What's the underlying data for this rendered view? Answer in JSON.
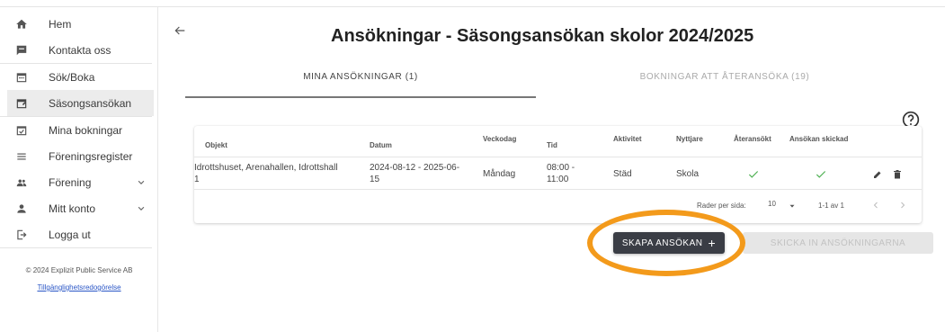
{
  "sidebar": {
    "items": [
      {
        "label": "Hem",
        "icon": "home-icon"
      },
      {
        "label": "Kontakta oss",
        "icon": "message-icon"
      },
      {
        "label": "Sök/Boka",
        "icon": "calendar-icon"
      },
      {
        "label": "Säsongsansökan",
        "icon": "calendar-edit-icon",
        "active": true
      },
      {
        "label": "Mina bokningar",
        "icon": "calendar-check-icon"
      },
      {
        "label": "Föreningsregister",
        "icon": "list-icon"
      },
      {
        "label": "Förening",
        "icon": "group-icon",
        "expandable": true
      },
      {
        "label": "Mitt konto",
        "icon": "person-icon",
        "expandable": true
      },
      {
        "label": "Logga ut",
        "icon": "logout-icon"
      }
    ],
    "copyright": "© 2024 Explizit Public Service AB",
    "accessibility_link": "Tillgänglighetsredogörelse"
  },
  "header": {
    "title": "Ansökningar - Säsongsansökan skolor 2024/2025"
  },
  "tabs": [
    {
      "label": "MINA ANSÖKNINGAR (1)",
      "active": true
    },
    {
      "label": "BOKNINGAR ATT ÅTERANSÖKA (19)",
      "active": false
    }
  ],
  "table": {
    "columns": [
      "Objekt",
      "Datum",
      "Veckodag",
      "Tid",
      "Aktivitet",
      "Nyttjare",
      "Återansökt",
      "Ansökan skickad"
    ],
    "rows": [
      {
        "objekt_line1": "Idrottshuset, Arenahallen, Idrottshall",
        "objekt_line2": "1",
        "datum_line1": "2024-08-12 - 2025-06-",
        "datum_line2": "15",
        "veckodag": "Måndag",
        "tid_line1": "08:00 -",
        "tid_line2": "11:00",
        "aktivitet": "Städ",
        "nyttjare": "Skola",
        "ateransokt": true,
        "ansokan_skickad": true
      }
    ],
    "pagination": {
      "rows_per_page_label": "Rader per sida:",
      "rows_per_page": "10",
      "range": "1-1 av 1"
    }
  },
  "buttons": {
    "create": "SKAPA ANSÖKAN",
    "send": "SKICKA IN ANSÖKNINGARNA"
  },
  "colors": {
    "highlight": "#f39a1b",
    "check": "#4caf50",
    "primary_button": "#3a3d45"
  }
}
